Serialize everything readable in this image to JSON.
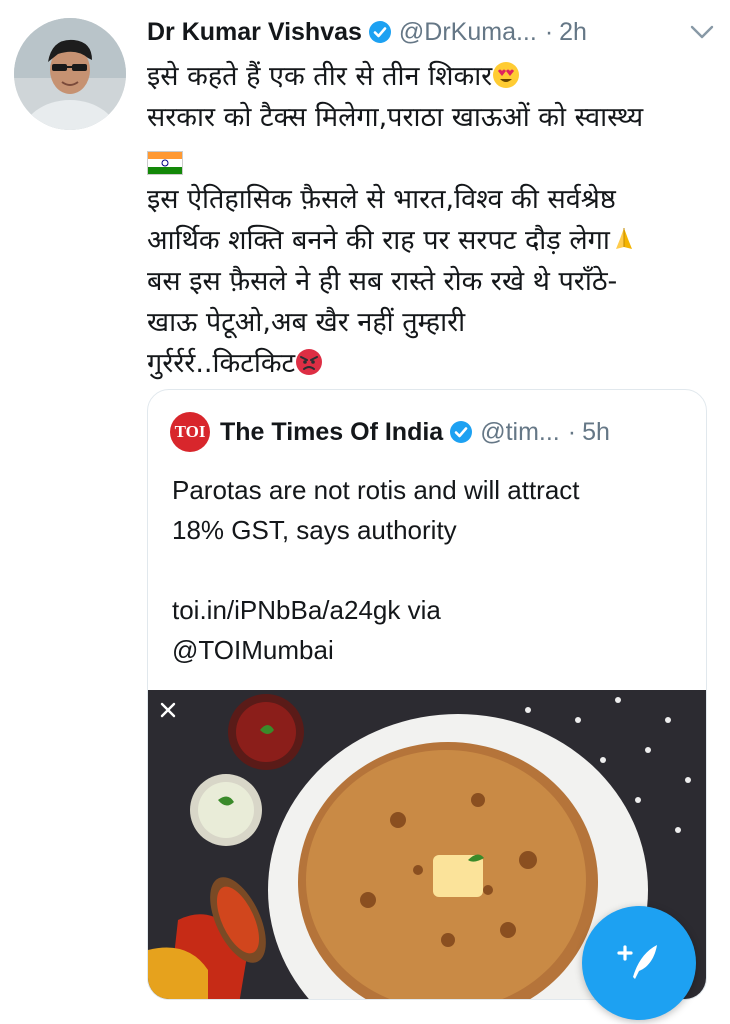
{
  "tweet": {
    "author_name": "Dr Kumar Vishvas",
    "handle": "@DrKuma...",
    "separator": "·",
    "time": "2h",
    "lines": [
      "इसे कहते हैं एक तीर से तीन शिकार",
      "सरकार को टैक्स मिलेगा,पराठा खाऊओं  को स्वास्थ्य",
      "इस ऐतिहासिक फ़ैसले से भारत,विश्व की सर्वश्रेष्ठ",
      "आर्थिक शक्ति बनने की राह पर सरपट दौड़ लेगा",
      "बस इस फ़ैसले ने ही सब रास्ते रोक रखे थे पराँठे-",
      "खाऊ पेटूओ,अब खैर नहीं तुम्हारी",
      "गुर्रर्रर्र..किटकिट"
    ],
    "emojis": [
      "heart-eyes-emoji",
      "indian-flag-emoji",
      "folded-hands-emoji",
      "angry-face-emoji"
    ]
  },
  "quoted": {
    "logo_text": "TOI",
    "author_name": "The Times Of India",
    "handle": "@tim...",
    "separator": "·",
    "time": "5h",
    "text_lines": [
      "Parotas are not rotis and will attract",
      "18% GST, says authority",
      "toi.in/iPNbBa/a24gk via",
      "@TOIMumbai"
    ],
    "image_alt": "paratha with butter on a plate"
  },
  "colors": {
    "accent": "#1da1f2",
    "text": "#14171a",
    "secondary": "#657786",
    "toi_red": "#d8262c"
  },
  "icons": {
    "verified": "verified-badge-icon",
    "chevron": "chevron-down-icon",
    "close": "close-icon",
    "compose": "compose-tweet-icon"
  }
}
